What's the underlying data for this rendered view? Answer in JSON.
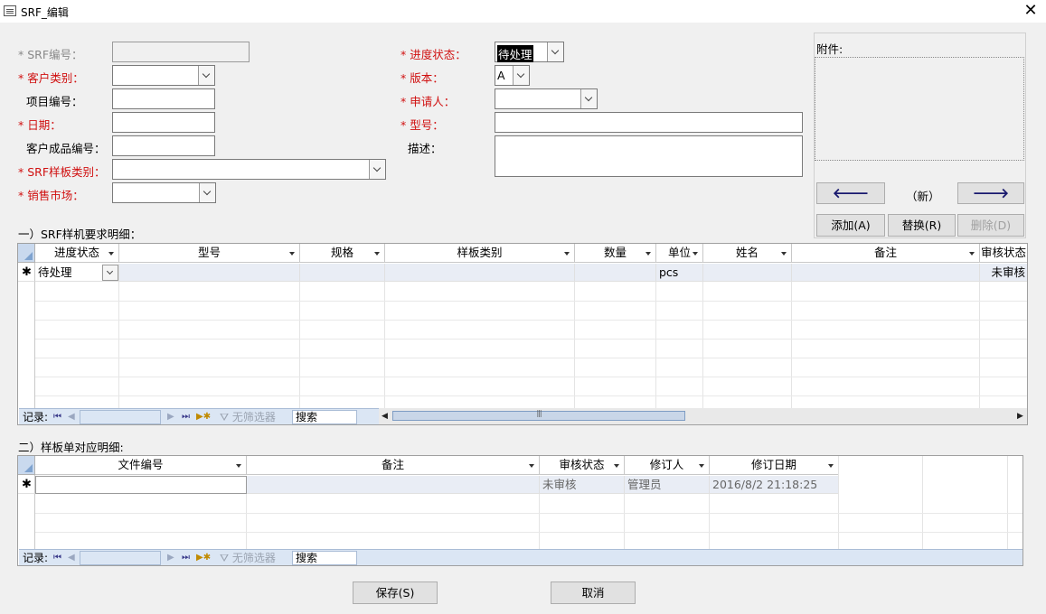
{
  "window": {
    "title": "SRF_编辑"
  },
  "form": {
    "srf_no": {
      "label": "* SRF编号：",
      "value": ""
    },
    "customer_type": {
      "label": "* 客户类别：",
      "value": ""
    },
    "project_no": {
      "label": "项目编号：",
      "value": ""
    },
    "date": {
      "label": "* 日期：",
      "value": ""
    },
    "customer_product_no": {
      "label": "客户成品编号：",
      "value": ""
    },
    "srf_sample_type": {
      "label": "* SRF样板类别：",
      "value": ""
    },
    "sales_market": {
      "label": "* 销售市场：",
      "value": ""
    },
    "progress_status": {
      "label": "* 进度状态：",
      "value": "待处理"
    },
    "version": {
      "label": "* 版本：",
      "value": "A"
    },
    "applicant": {
      "label": "* 申请人：",
      "value": ""
    },
    "model": {
      "label": "* 型号：",
      "value": ""
    },
    "description": {
      "label": "描述：",
      "value": ""
    }
  },
  "attachment": {
    "label": "附件:",
    "prev": "🡐",
    "next": "🡒",
    "status": "（新）",
    "add_label": "添加(A)",
    "replace_label": "替换(R)",
    "delete_label": "删除(D)"
  },
  "section1": {
    "title": "一）SRF样机要求明细：",
    "columns": [
      "进度状态",
      "型号",
      "规格",
      "样板类别",
      "数量",
      "单位",
      "姓名",
      "备注",
      "审核状态"
    ],
    "new_row": {
      "status": "待处理",
      "unit": "pcs",
      "review": "未审核"
    },
    "nav": {
      "record_label": "记录:",
      "filter_label": "无筛选器",
      "search_label": "搜索"
    }
  },
  "section2": {
    "title": "二）样板单对应明细:",
    "columns": [
      "文件编号",
      "备注",
      "审核状态",
      "修订人",
      "修订日期"
    ],
    "new_row": {
      "review": "未审核",
      "reviser": "管理员",
      "revise_date": "2016/8/2 21:18:25"
    },
    "nav": {
      "record_label": "记录:",
      "filter_label": "无筛选器",
      "search_label": "搜索"
    }
  },
  "footer": {
    "save_label": "保存(S)",
    "cancel_label": "取消"
  },
  "colors": {
    "required": "#d01010",
    "nav_bg": "#dbe6f4",
    "selector": "#c9d9ee"
  }
}
